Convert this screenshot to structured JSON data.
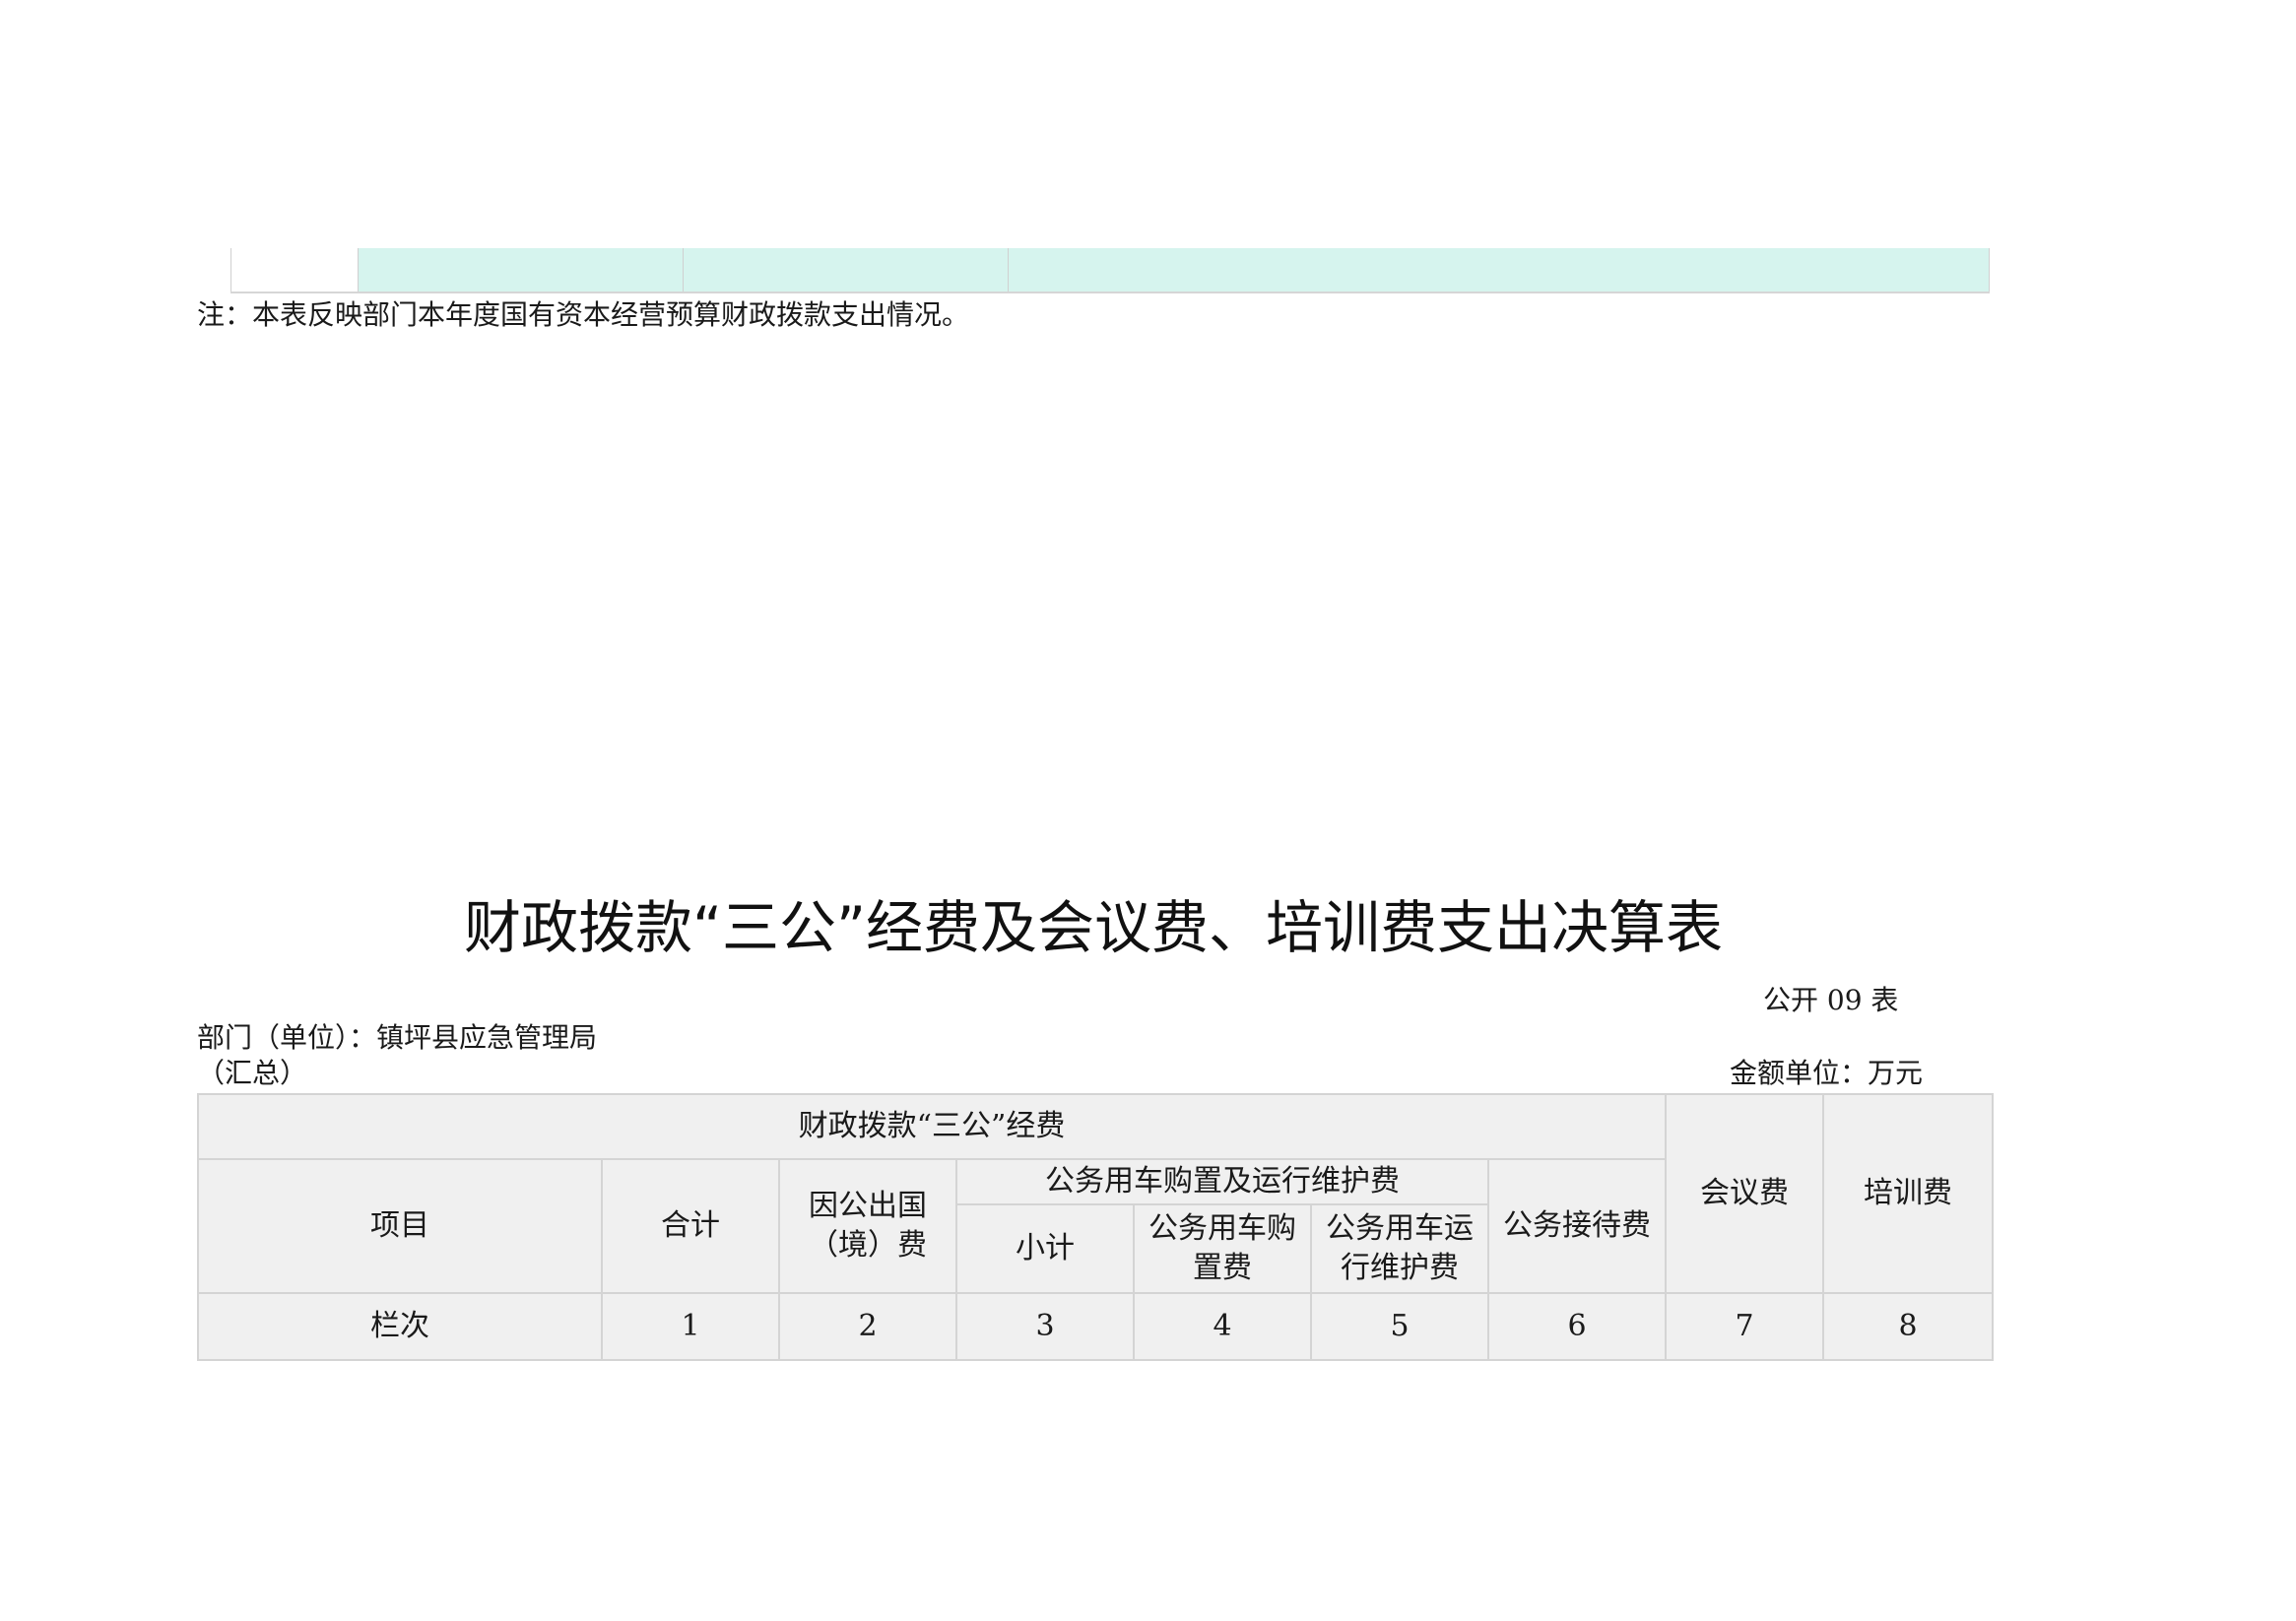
{
  "note": "注：本表反映部门本年度国有资本经营预算财政拨款支出情况。",
  "title": "财政拨款“三公”经费及会议费、培训费支出决算表",
  "form_no": "公开 09 表",
  "department": "部门（单位）：镇坪县应急管理局",
  "summary": "（汇总）",
  "unit": "金额单位：万元",
  "table": {
    "group_header": "财政拨款“三公”经费",
    "project": "项目",
    "total": "合计",
    "abroad": "因公出国（境）费",
    "vehicle_group": "公务用车购置及运行维护费",
    "subtotal": "小计",
    "vehicle_purchase": "公务用车购置费",
    "vehicle_operation": "公务用车运行维护费",
    "reception": "公务接待费",
    "meeting": "会议费",
    "training": "培训费",
    "row_label": "栏次",
    "column_numbers": [
      "1",
      "2",
      "3",
      "4",
      "5",
      "6",
      "7",
      "8"
    ]
  }
}
